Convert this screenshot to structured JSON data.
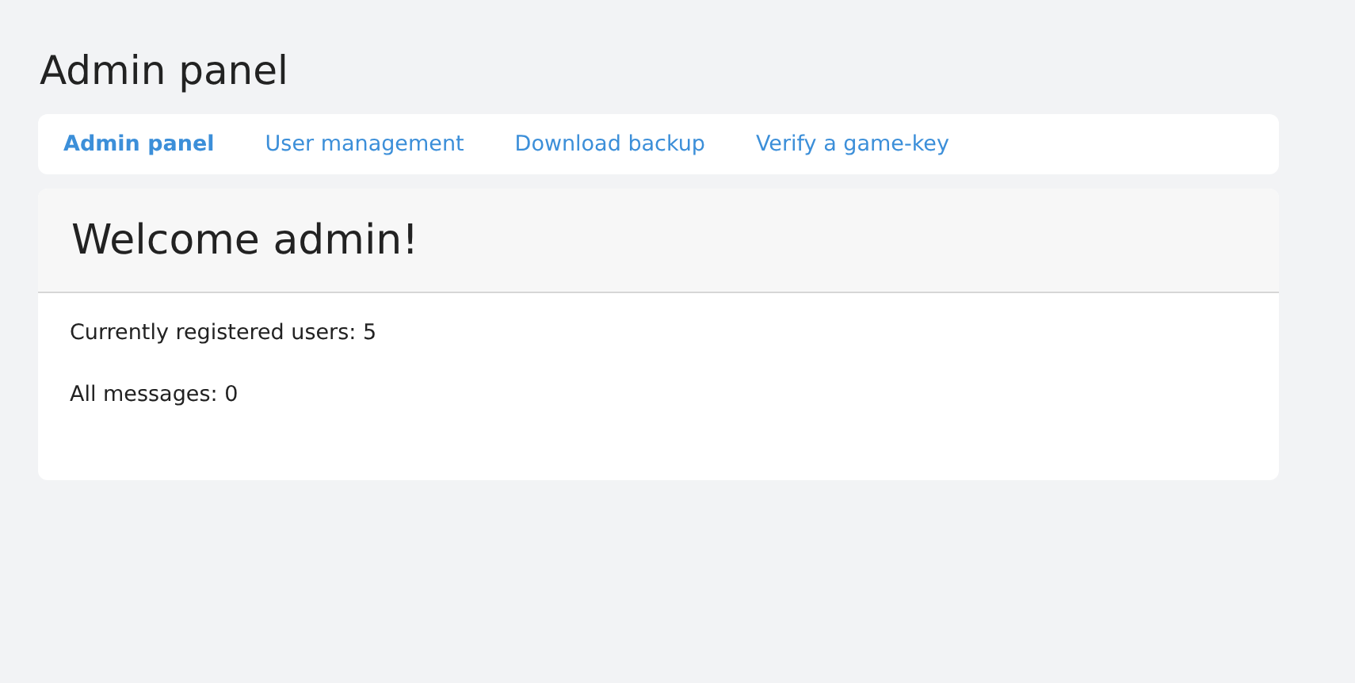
{
  "page_title": "Admin panel",
  "nav": [
    {
      "label": "Admin panel",
      "selected": true
    },
    {
      "label": "User management",
      "selected": false
    },
    {
      "label": "Download backup",
      "selected": false
    },
    {
      "label": "Verify a game-key",
      "selected": false
    }
  ],
  "card": {
    "heading": "Welcome admin!",
    "lines": [
      "Currently registered users: 5",
      "All messages: 0"
    ]
  }
}
